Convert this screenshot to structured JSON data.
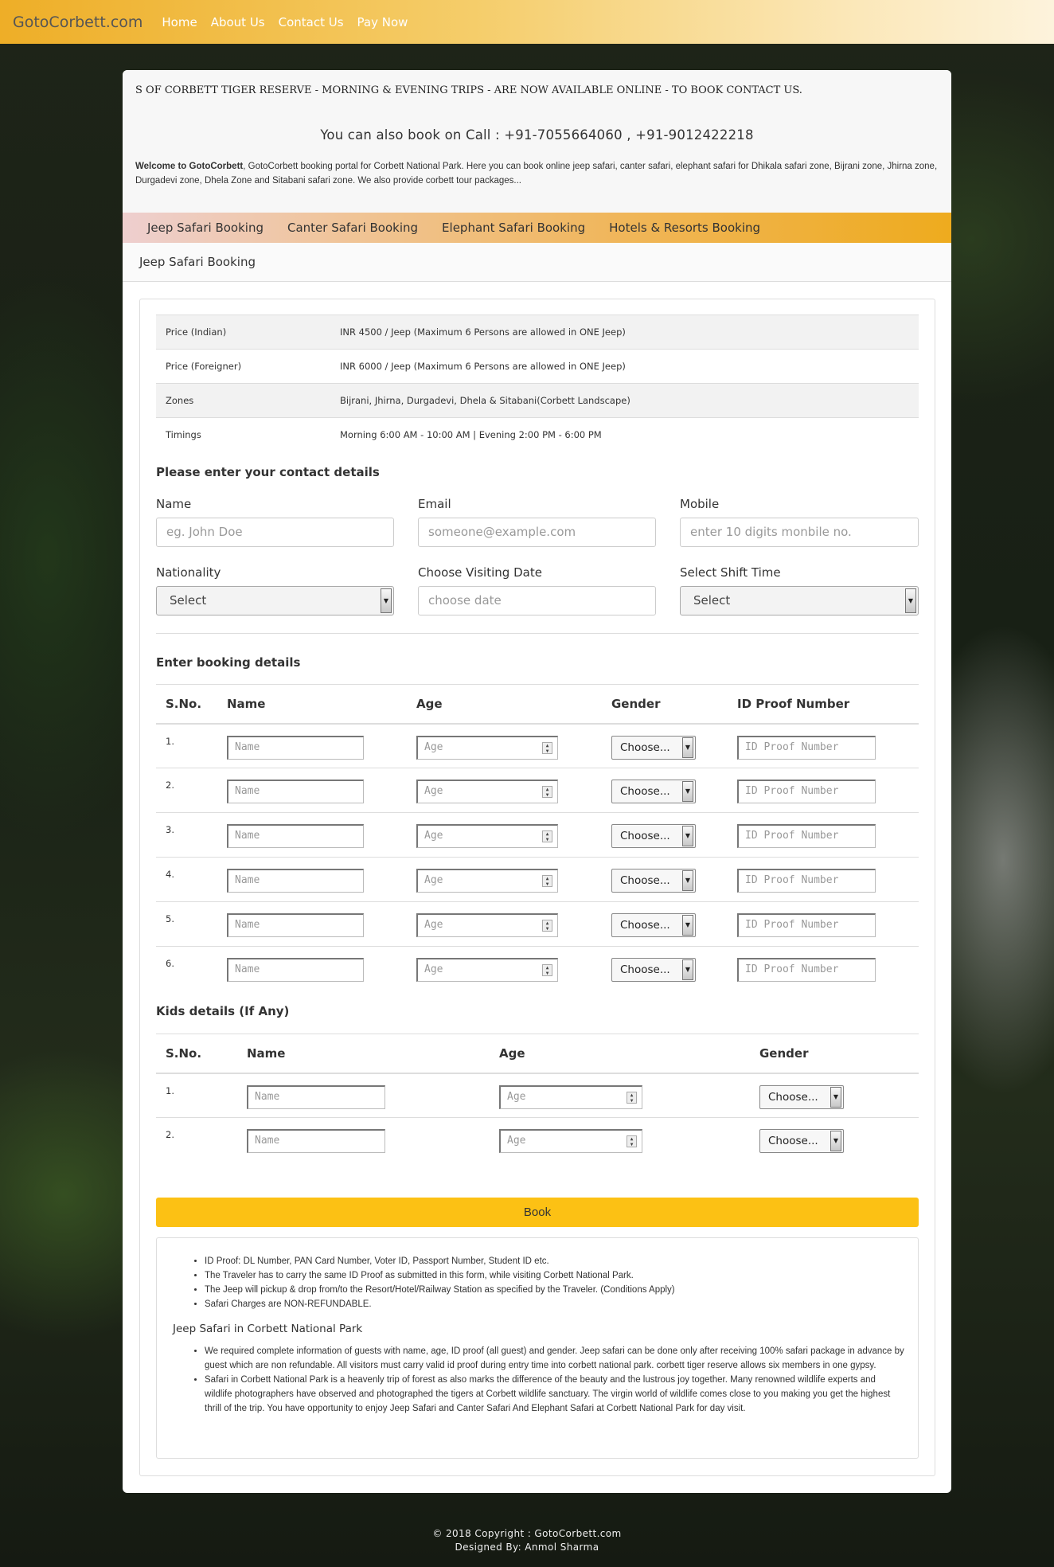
{
  "navbar": {
    "brand": "GotoCorbett.com",
    "links": [
      "Home",
      "About Us",
      "Contact Us",
      "Pay Now"
    ]
  },
  "header": {
    "marquee": "S OF CORBETT TIGER RESERVE - MORNING & EVENING TRIPS - ARE NOW AVAILABLE ONLINE - TO BOOK CONTACT US.",
    "call_line": "You can also book on Call : +91-7055664060 , +91-9012422218",
    "welcome_bold": "Welcome to GotoCorbett",
    "welcome_text": ", GotoCorbett booking portal for Corbett National Park. Here you can book online jeep safari, canter safari, elephant safari for Dhikala safari zone, Bijrani zone, Jhirna zone, Durgadevi zone, Dhela Zone and Sitabani safari zone. We also provide corbett tour packages..."
  },
  "tabs": [
    "Jeep Safari Booking",
    "Canter Safari Booking",
    "Elephant Safari Booking",
    "Hotels & Resorts Booking"
  ],
  "subheading": "Jeep Safari Booking",
  "price_table": [
    {
      "label": "Price (Indian)",
      "value": "INR 4500 / Jeep (Maximum 6 Persons are allowed in ONE Jeep)"
    },
    {
      "label": "Price (Foreigner)",
      "value": "INR 6000 / Jeep (Maximum 6 Persons are allowed in ONE Jeep)"
    },
    {
      "label": "Zones",
      "value": "Bijrani, Jhirna, Durgadevi, Dhela & Sitabani(Corbett Landscape)"
    },
    {
      "label": "Timings",
      "value": "Morning 6:00 AM - 10:00 AM  |  Evening 2:00 PM - 6:00 PM"
    }
  ],
  "contact": {
    "title": "Please enter your contact details",
    "name_label": "Name",
    "name_placeholder": "eg. John Doe",
    "email_label": "Email",
    "email_placeholder": "someone@example.com",
    "mobile_label": "Mobile",
    "mobile_placeholder": "enter 10 digits monbile no.",
    "nationality_label": "Nationality",
    "nationality_value": "Select",
    "date_label": "Choose Visiting Date",
    "date_placeholder": "choose date",
    "shift_label": "Select Shift Time",
    "shift_value": "Select"
  },
  "booking": {
    "title": "Enter booking details",
    "headers": [
      "S.No.",
      "Name",
      "Age",
      "Gender",
      "ID Proof Number"
    ],
    "rows": [
      "1.",
      "2.",
      "3.",
      "4.",
      "5.",
      "6."
    ],
    "name_placeholder": "Name",
    "age_placeholder": "Age",
    "gender_value": "Choose...",
    "id_placeholder": "ID Proof Number"
  },
  "kids": {
    "title": "Kids details (If Any)",
    "headers": [
      "S.No.",
      "Name",
      "Age",
      "Gender"
    ],
    "rows": [
      "1.",
      "2."
    ],
    "name_placeholder": "Name",
    "age_placeholder": "Age",
    "gender_value": "Choose..."
  },
  "book_button": "Book",
  "notes": {
    "list1": [
      "ID Proof: DL Number, PAN Card Number, Voter ID, Passport Number, Student ID etc.",
      "The Traveler has to carry the same ID Proof as submitted in this form, while visiting Corbett National Park.",
      "The Jeep will pickup & drop from/to the Resort/Hotel/Railway Station as specified by the Traveler. (Conditions Apply)",
      "Safari Charges are NON-REFUNDABLE."
    ],
    "title": "Jeep Safari in Corbett National Park",
    "list2": [
      "We required complete information of guests with name, age, ID proof (all guest) and gender. Jeep safari can be done only after receiving 100% safari package in advance by guest which are non refundable. All visitors must carry valid id proof during entry time into corbett national park. corbett tiger reserve allows six members in one gypsy.",
      "Safari in Corbett National Park is a heavenly trip of forest as also marks the difference of the beauty and the lustrous joy together. Many renowned wildlife experts and wildlife photographers have observed and photographed the tigers at Corbett wildlife sanctuary. The virgin world of wildlife comes close to you making you get the highest thrill of the trip. You have opportunity to enjoy Jeep Safari and Canter Safari And Elephant Safari at Corbett National Park for day visit."
    ]
  },
  "footer": {
    "copyright": "© 2018 Copyright : GotoCorbett.com",
    "designed_by": "Designed By: Anmol Sharma"
  }
}
